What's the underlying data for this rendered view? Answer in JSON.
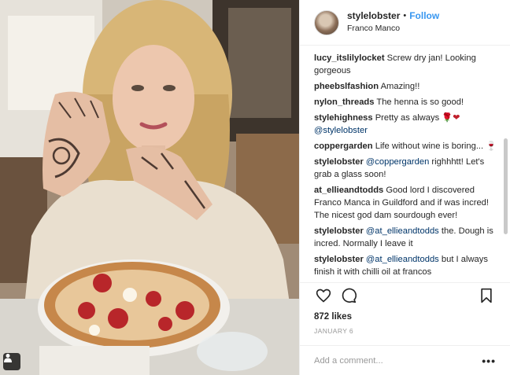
{
  "post": {
    "username": "stylelobster",
    "separator": "•",
    "follow_label": "Follow",
    "location": "Franco Manco",
    "likes": "872 likes",
    "date": "JANUARY 6",
    "add_comment_placeholder": "Add a comment...",
    "more_label": "•••"
  },
  "comments": [
    {
      "author": "lucy_itslilylocket",
      "text": "Screw dry jan! Looking gorgeous"
    },
    {
      "author": "pheebslfashion",
      "text": "Amazing!!"
    },
    {
      "author": "nylon_threads",
      "text": "The henna is so good!"
    },
    {
      "author": "stylehighness",
      "text": "Pretty as always ",
      "emoji": "🌹❤",
      "mention": "@stylelobster"
    },
    {
      "author": "coppergarden",
      "text": "Life without wine is boring... 🍷"
    },
    {
      "author": "stylelobster",
      "mention": "@coppergarden",
      "text": " righhhtt! Let's grab a glass soon!"
    },
    {
      "author": "at_ellieandtodds",
      "text": "Good lord I discovered Franco Manca in Guildford and if was incred! The nicest god dam sourdough ever!"
    },
    {
      "author": "stylelobster",
      "mention": "@at_ellieandtodds",
      "text": " the. Dough is incred. Normally I leave it"
    },
    {
      "author": "stylelobster",
      "mention": "@at_ellieandtodds",
      "text": " but I always finish it with chilli oil at francos"
    }
  ],
  "icons": {
    "like": "heart-icon",
    "comment": "comment-icon",
    "save": "bookmark-icon",
    "tag": "user-tag-icon"
  },
  "colors": {
    "accent": "#3897f0",
    "mention": "#003569",
    "muted": "#999999"
  }
}
